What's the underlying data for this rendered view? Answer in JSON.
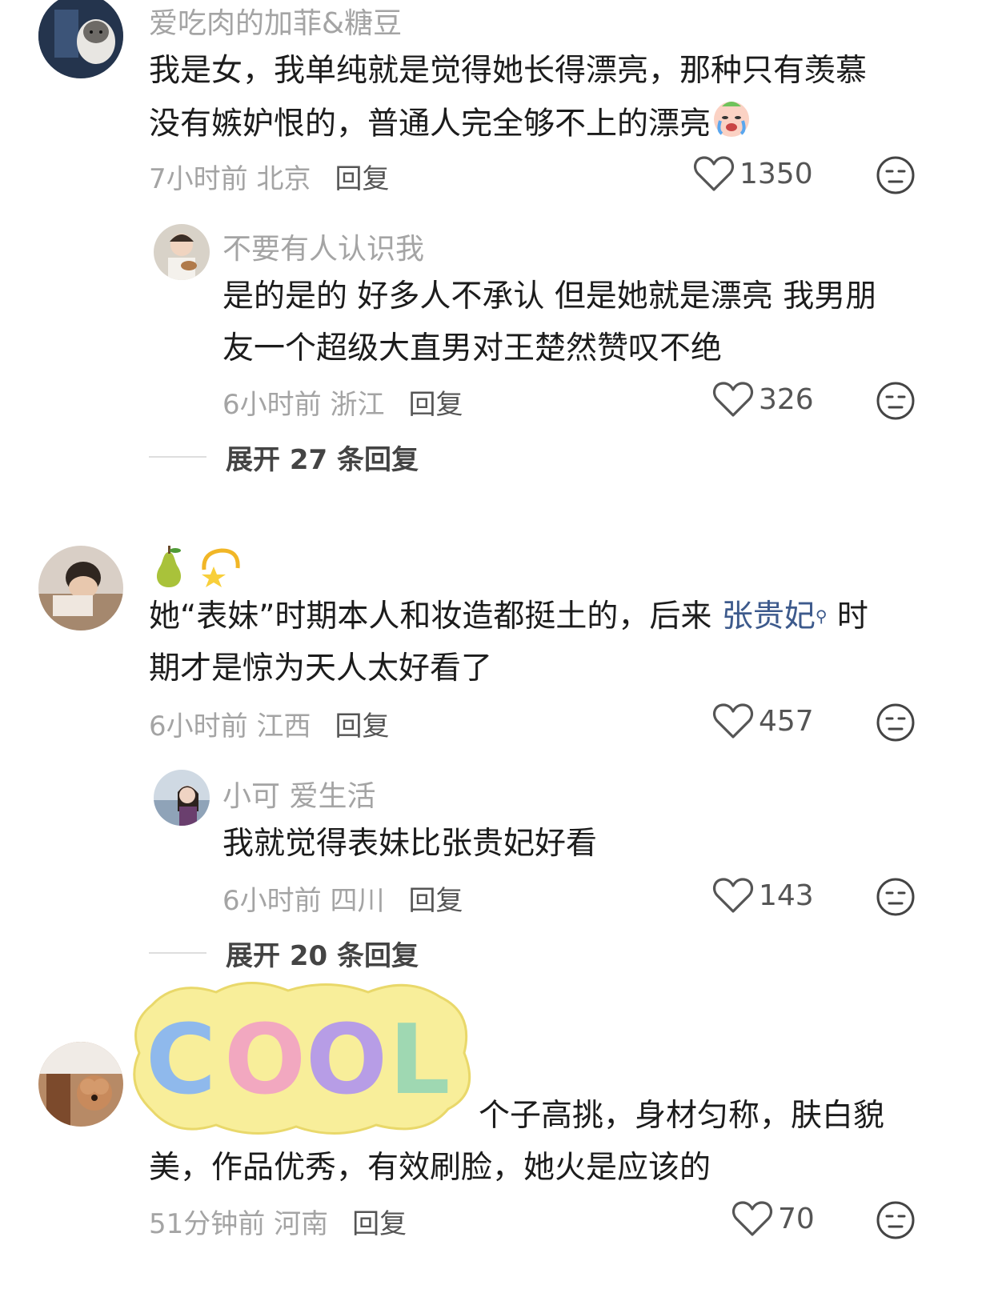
{
  "comments": [
    {
      "username": "爱吃肉的加菲&糖豆",
      "text_line1": "我是女，我单纯就是觉得她长得漂亮，那种只有羡慕",
      "text_line2": "没有嫉妒恨的，普通人完全够不上的漂亮",
      "time": "7小时前",
      "location": "北京",
      "reply_label": "回复",
      "likes": "1350",
      "replies": [
        {
          "username": "不要有人认识我",
          "text_line1": "是的是的 好多人不承认 但是她就是漂亮 我男朋",
          "text_line2": "友一个超级大直男对王楚然赞叹不绝",
          "time": "6小时前",
          "location": "浙江",
          "reply_label": "回复",
          "likes": "326"
        }
      ],
      "expand_label": "展开 27 条回复"
    },
    {
      "username": "",
      "text_pre": "她“表妹”时期本人和妆造都挺土的，后来 ",
      "text_link": "张贵妃",
      "text_post": " 时",
      "text_line2": "期才是惊为天人太好看了",
      "time": "6小时前",
      "location": "江西",
      "reply_label": "回复",
      "likes": "457",
      "replies": [
        {
          "username": "小可 爱生活",
          "text_line1": "我就觉得表妹比张贵妃好看",
          "time": "6小时前",
          "location": "四川",
          "reply_label": "回复",
          "likes": "143"
        }
      ],
      "expand_label": "展开 20 条回复"
    },
    {
      "text_line1": "个子高挑，身材匀称，肤白貌",
      "text_line2": "美，作品优秀，有效刷脸，她火是应该的",
      "time": "51分钟前",
      "location": "河南",
      "reply_label": "回复",
      "likes": "70"
    }
  ],
  "sticker": {
    "text": "COOL",
    "letters": [
      "C",
      "O",
      "O",
      "L"
    ]
  },
  "colors": {
    "link": "#3d5a8c",
    "meta": "#a4a4a4",
    "sticker_bg": "#f8ee9a"
  }
}
